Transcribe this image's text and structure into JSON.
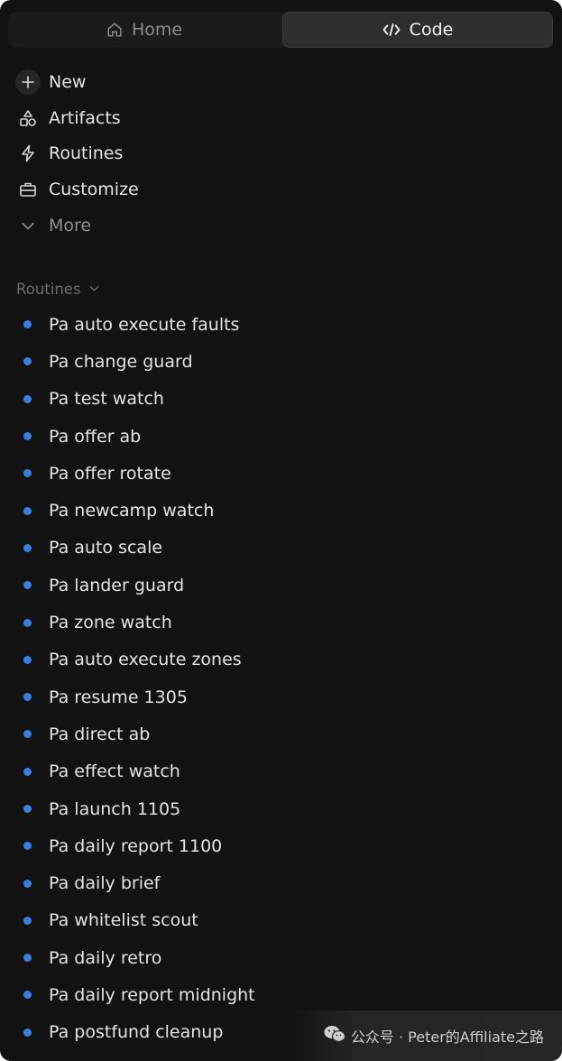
{
  "tabs": [
    {
      "label": "Home",
      "icon": "home-icon",
      "active": false
    },
    {
      "label": "Code",
      "icon": "code-icon",
      "active": true
    }
  ],
  "nav": {
    "new_label": "New",
    "artifacts_label": "Artifacts",
    "routines_label": "Routines",
    "customize_label": "Customize",
    "more_label": "More"
  },
  "section": {
    "title": "Routines"
  },
  "routines": [
    "Pa auto execute faults",
    "Pa change guard",
    "Pa test watch",
    "Pa offer ab",
    "Pa offer rotate",
    "Pa newcamp watch",
    "Pa auto scale",
    "Pa lander guard",
    "Pa zone watch",
    "Pa auto execute zones",
    "Pa resume 1305",
    "Pa direct ab",
    "Pa effect watch",
    "Pa launch 1105",
    "Pa daily report 1100",
    "Pa daily brief",
    "Pa whitelist scout",
    "Pa daily retro",
    "Pa daily report midnight",
    "Pa postfund cleanup"
  ],
  "watermark": {
    "text": "公众号 · Peter的Affiliate之路",
    "icon": "wechat-icon"
  },
  "colors": {
    "background": "#121212",
    "status_dot": "#3a80e0",
    "text": "#e4e4e4",
    "muted_text": "#8f8f8f"
  }
}
